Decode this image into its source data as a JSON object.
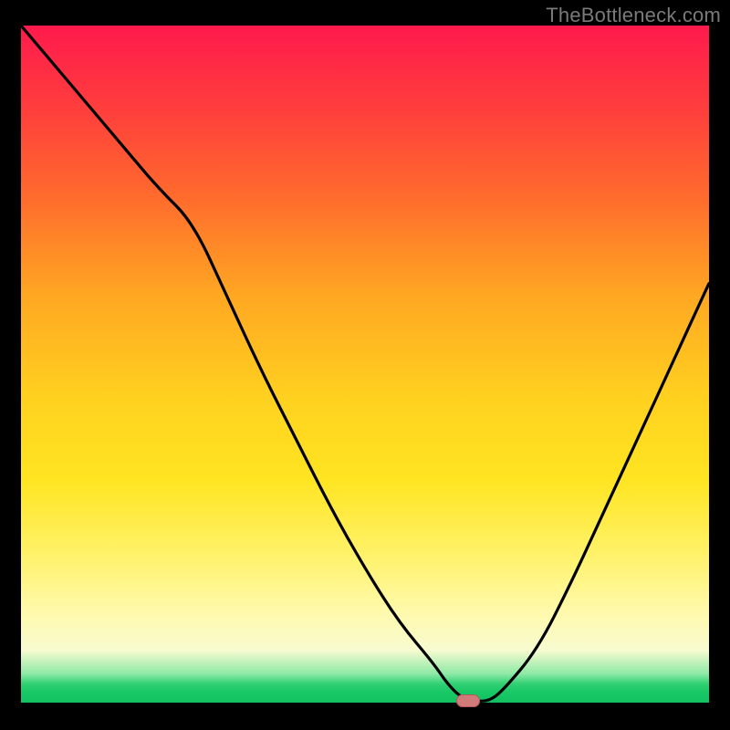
{
  "watermark": "TheBottleneck.com",
  "colors": {
    "curve": "#000000",
    "marker_fill": "#d07a7a",
    "marker_stroke": "#b55a5a",
    "background": "#000000"
  },
  "chart_data": {
    "type": "line",
    "x": [
      0,
      5,
      10,
      15,
      20,
      25,
      30,
      35,
      40,
      45,
      50,
      55,
      60,
      62,
      64,
      66,
      68,
      70,
      75,
      80,
      85,
      90,
      95,
      100
    ],
    "values": [
      100,
      94,
      88,
      82,
      76,
      71,
      60,
      49,
      39,
      29,
      20,
      12,
      6,
      3,
      1,
      0.5,
      0.5,
      2,
      8,
      18,
      29,
      40,
      51,
      62
    ],
    "baseline": 0,
    "marker": {
      "x": 65,
      "y": 0
    },
    "title": "",
    "xlabel": "",
    "ylabel": "",
    "xlim": [
      0,
      100
    ],
    "ylim": [
      0,
      100
    ]
  }
}
